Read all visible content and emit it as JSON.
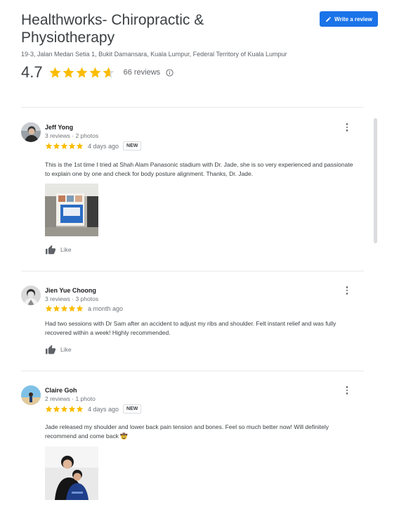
{
  "business": {
    "name": "Healthworks- Chiropractic & Physiotherapy",
    "address": "19-3, Jalan Medan Setia 1, Bukit Damansara, Kuala Lumpur, Federal Territory of Kuala Lumpur",
    "rating": "4.7",
    "rating_value": 4.7,
    "review_count": "66 reviews"
  },
  "write_review_label": "Write a review",
  "colors": {
    "accent": "#1a73e8",
    "star": "#fbbc04",
    "star_empty": "#dadce0"
  },
  "reviews": [
    {
      "name": "Jeff Yong",
      "meta": "3 reviews · 2 photos",
      "rating": 5,
      "time": "4 days ago",
      "badge": "NEW",
      "text": "This is the 1st time I tried at Shah Alam Panasonic stadium with Dr. Jade, she is so very experienced and passionate to explain one by one and check for body posture alignment. Thanks, Dr. Jade.",
      "like_label": "Like"
    },
    {
      "name": "Jien Yue Choong",
      "meta": "3 reviews · 3 photos",
      "rating": 5,
      "time": "a month ago",
      "text": "Had two sessions with Dr Sam after an accident to adjust my ribs and shoulder. Felt instant relief and was fully recovered within a week! Highly recommended.",
      "like_label": "Like"
    },
    {
      "name": "Claire Goh",
      "meta": "2 reviews · 1 photo",
      "rating": 5,
      "time": "4 days ago",
      "badge": "NEW",
      "text": "Jade released my shoulder and lower back pain tension and bones. Feel so much better now! Will definitely recommend and come back 🤠"
    }
  ]
}
